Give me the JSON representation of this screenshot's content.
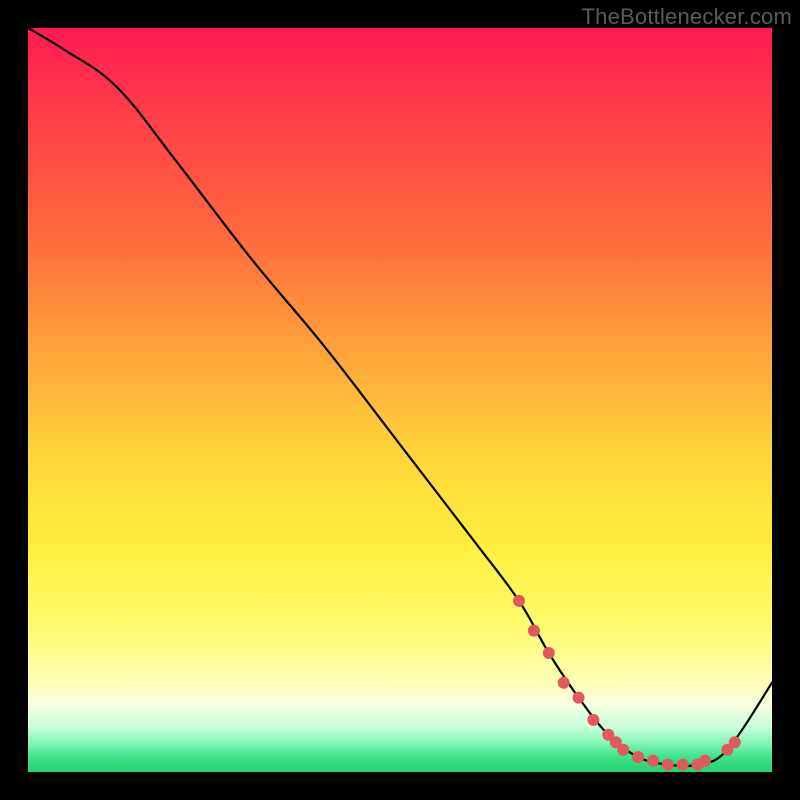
{
  "watermark": "TheBottlenecker.com",
  "chart_data": {
    "type": "line",
    "title": "",
    "xlabel": "",
    "ylabel": "",
    "xlim": [
      0,
      100
    ],
    "ylim": [
      0,
      100
    ],
    "series": [
      {
        "name": "curve",
        "x": [
          0,
          5,
          12,
          20,
          30,
          40,
          50,
          60,
          66,
          70,
          74,
          78,
          82,
          86,
          90,
          94,
          100
        ],
        "y": [
          100,
          97,
          92,
          82,
          69,
          57,
          44,
          31,
          23,
          16,
          10,
          5,
          2,
          1,
          1,
          3,
          12
        ]
      }
    ],
    "markers": [
      {
        "x": 66,
        "y": 23
      },
      {
        "x": 68,
        "y": 19
      },
      {
        "x": 70,
        "y": 16
      },
      {
        "x": 72,
        "y": 12
      },
      {
        "x": 74,
        "y": 10
      },
      {
        "x": 76,
        "y": 7
      },
      {
        "x": 78,
        "y": 5
      },
      {
        "x": 79,
        "y": 4
      },
      {
        "x": 80,
        "y": 3
      },
      {
        "x": 82,
        "y": 2
      },
      {
        "x": 84,
        "y": 1.5
      },
      {
        "x": 86,
        "y": 1
      },
      {
        "x": 88,
        "y": 1
      },
      {
        "x": 90,
        "y": 1
      },
      {
        "x": 91,
        "y": 1.5
      },
      {
        "x": 94,
        "y": 3
      },
      {
        "x": 95,
        "y": 4
      }
    ],
    "colors": {
      "curve": "#000000",
      "marker": "#e15a5a"
    }
  }
}
